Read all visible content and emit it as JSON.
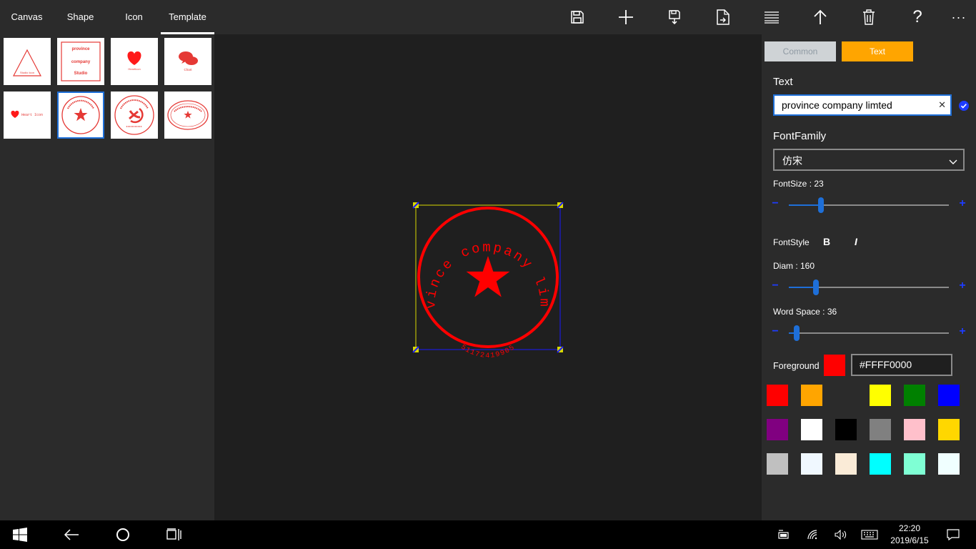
{
  "tabs": [
    {
      "label": "Canvas"
    },
    {
      "label": "Shape"
    },
    {
      "label": "Icon"
    },
    {
      "label": "Template",
      "active": true
    }
  ],
  "toolbar_icons": [
    "save-icon",
    "add-icon",
    "save-as-icon",
    "export-icon",
    "align-icon",
    "upload-icon",
    "delete-icon",
    "help-icon",
    "more-icon"
  ],
  "toolbar_help_glyph": "?",
  "toolbar_more_glyph": "···",
  "templates": [
    {
      "name": "triangle",
      "texts": [
        "Studio Icon"
      ]
    },
    {
      "name": "square",
      "texts": [
        "province",
        "company",
        "Studio"
      ]
    },
    {
      "name": "heart",
      "texts": [
        "HeartIcon"
      ]
    },
    {
      "name": "chat",
      "texts": [
        "Chart"
      ]
    },
    {
      "name": "heart-text",
      "texts": [
        "Heart Icon"
      ]
    },
    {
      "name": "circle-star",
      "selected": true,
      "texts": []
    },
    {
      "name": "circle-party",
      "texts": []
    },
    {
      "name": "ellipse-star",
      "texts": []
    }
  ],
  "stamp": {
    "text": "province company limted",
    "code": "51172419905",
    "color": "#FF0000"
  },
  "panel": {
    "seg_common": "Common",
    "seg_text": "Text",
    "text_label": "Text",
    "text_value": "province company limted",
    "clear_glyph": "✕",
    "fontfamily_label": "FontFamily",
    "fontfamily_value": "仿宋",
    "fontsize_label": "FontSize : 23",
    "fontstyle_label": "FontStyle",
    "bold_label": "B",
    "italic_label": "I",
    "diam_label": "Diam : 160",
    "wordspace_label": "Word Space : 36",
    "fontsize_level": 0.2,
    "diam_level": 0.17,
    "wordspace_level": 0.05,
    "minus": "−",
    "plus": "+",
    "foreground_label": "Foreground",
    "foreground_hex": "#FFFF0000",
    "swatches": [
      "#ff0000",
      "#ffa500",
      "#2b2b2b",
      "#ffff00",
      "#008000",
      "#0000ff",
      "#800080",
      "#ffffff",
      "#000000",
      "#808080",
      "#ffc0cb",
      "#ffd700",
      "#c0c0c0",
      "#f0f8ff",
      "#faebd7",
      "#00ffff",
      "#7fffd4",
      "#f0ffff"
    ]
  },
  "taskbar": {
    "time": "22:20",
    "date": "2019/6/15"
  }
}
